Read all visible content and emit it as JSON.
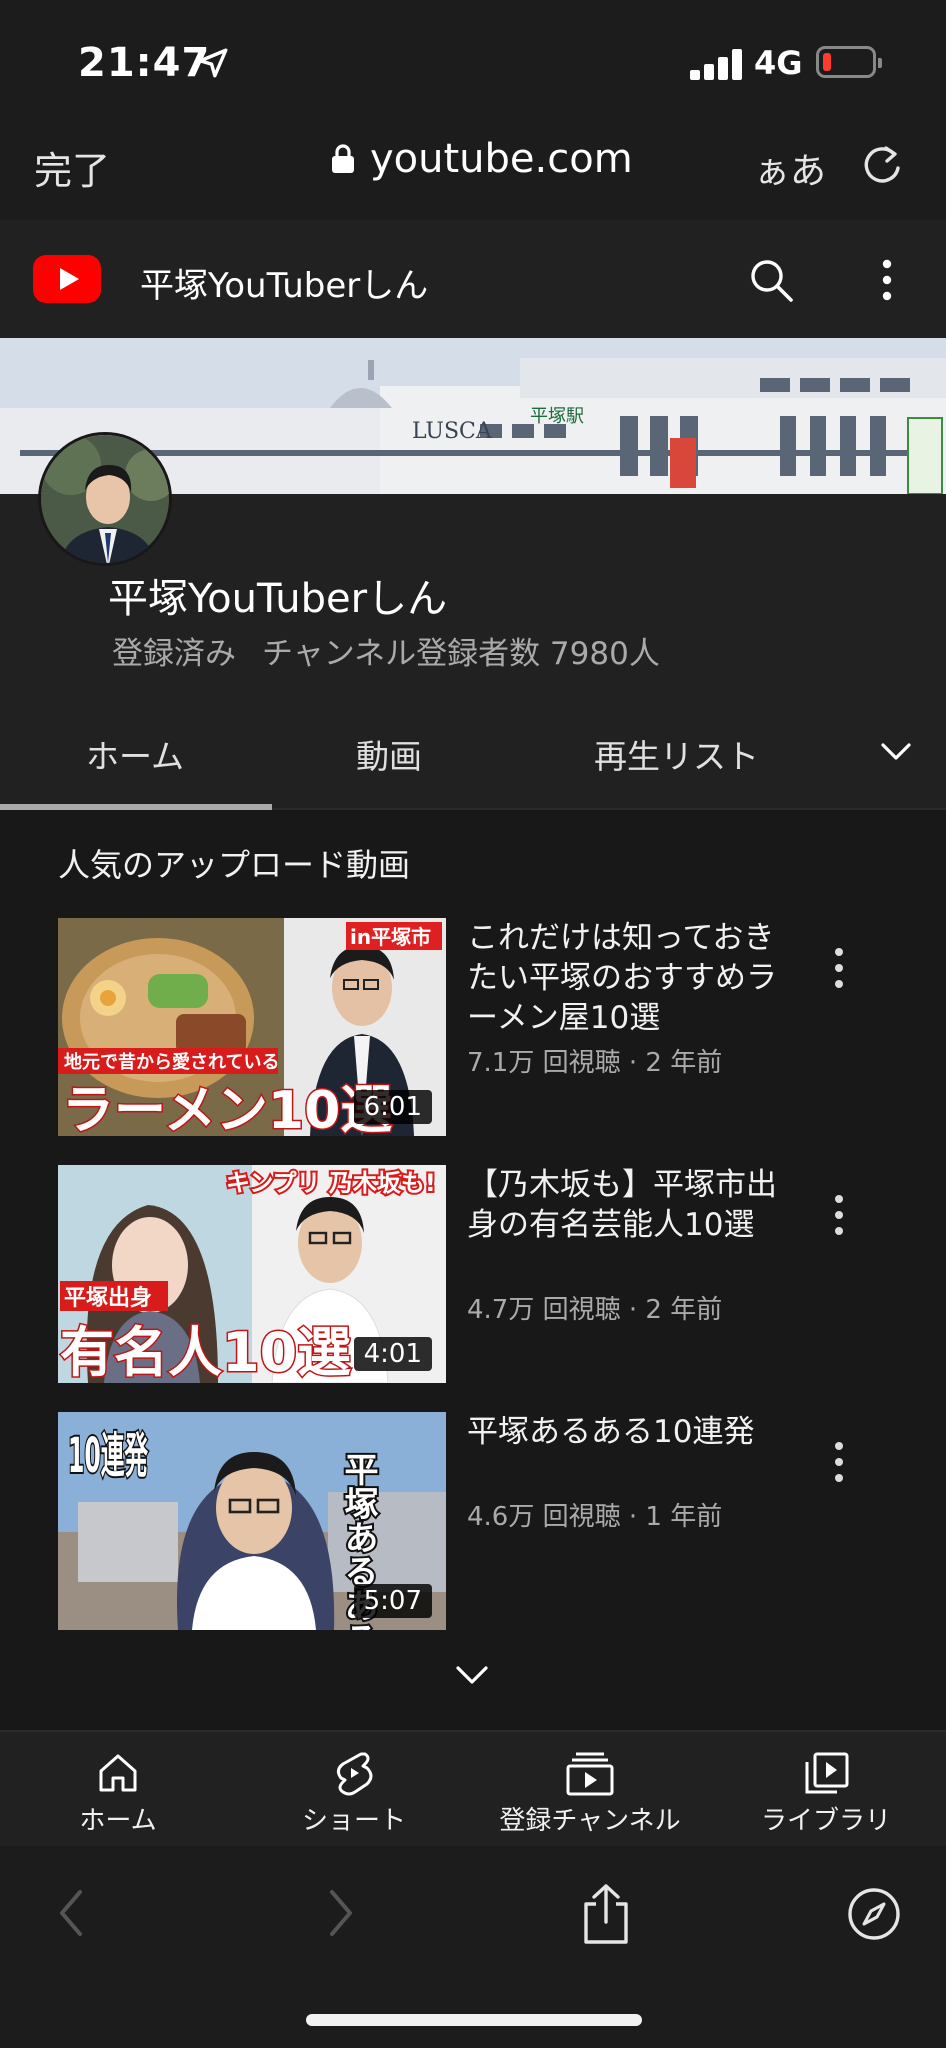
{
  "status_bar": {
    "time": "21:47",
    "network": "4G",
    "battery_level": 0.12
  },
  "browser": {
    "done_label": "完了",
    "url": "youtube.com",
    "text_size_label": "ぁあ"
  },
  "header": {
    "channel_title": "平塚YouTuberしん"
  },
  "channel": {
    "name": "平塚YouTuberしん",
    "subscribed_label": "登録済み",
    "subscribers": "チャンネル登録者数 7980人"
  },
  "tabs": [
    {
      "label": "ホーム",
      "active": true
    },
    {
      "label": "動画",
      "active": false
    },
    {
      "label": "再生リスト",
      "active": false
    }
  ],
  "section": {
    "title": "人気のアップロード動画"
  },
  "videos": [
    {
      "title": "これだけは知っておきたい平塚のおすすめラーメン屋10選",
      "meta": "7.1万 回視聴 · 2 年前",
      "duration": "6:01",
      "thumb_text": {
        "tag": "in平塚市",
        "sub": "地元で昔から愛されている",
        "main": "ラーメン10選"
      }
    },
    {
      "title": "【乃木坂も】平塚市出身の有名芸能人10選",
      "meta": "4.7万 回視聴 · 2 年前",
      "duration": "4:01",
      "thumb_text": {
        "tag": "キンプリ 乃木坂も!",
        "sub": "平塚出身",
        "main": "有名人10選"
      }
    },
    {
      "title": "平塚あるある10連発",
      "meta": "4.6万 回視聴 · 1 年前",
      "duration": "5:07",
      "thumb_text": {
        "left": "10連発",
        "right": "平塚あるある"
      }
    }
  ],
  "bottom_nav": [
    {
      "label": "ホーム",
      "icon": "home-icon"
    },
    {
      "label": "ショート",
      "icon": "shorts-icon"
    },
    {
      "label": "登録チャンネル",
      "icon": "subscriptions-icon"
    },
    {
      "label": "ライブラリ",
      "icon": "library-icon"
    }
  ],
  "banner_text": {
    "station_brand": "LUSCA",
    "station_name": "平塚駅"
  }
}
